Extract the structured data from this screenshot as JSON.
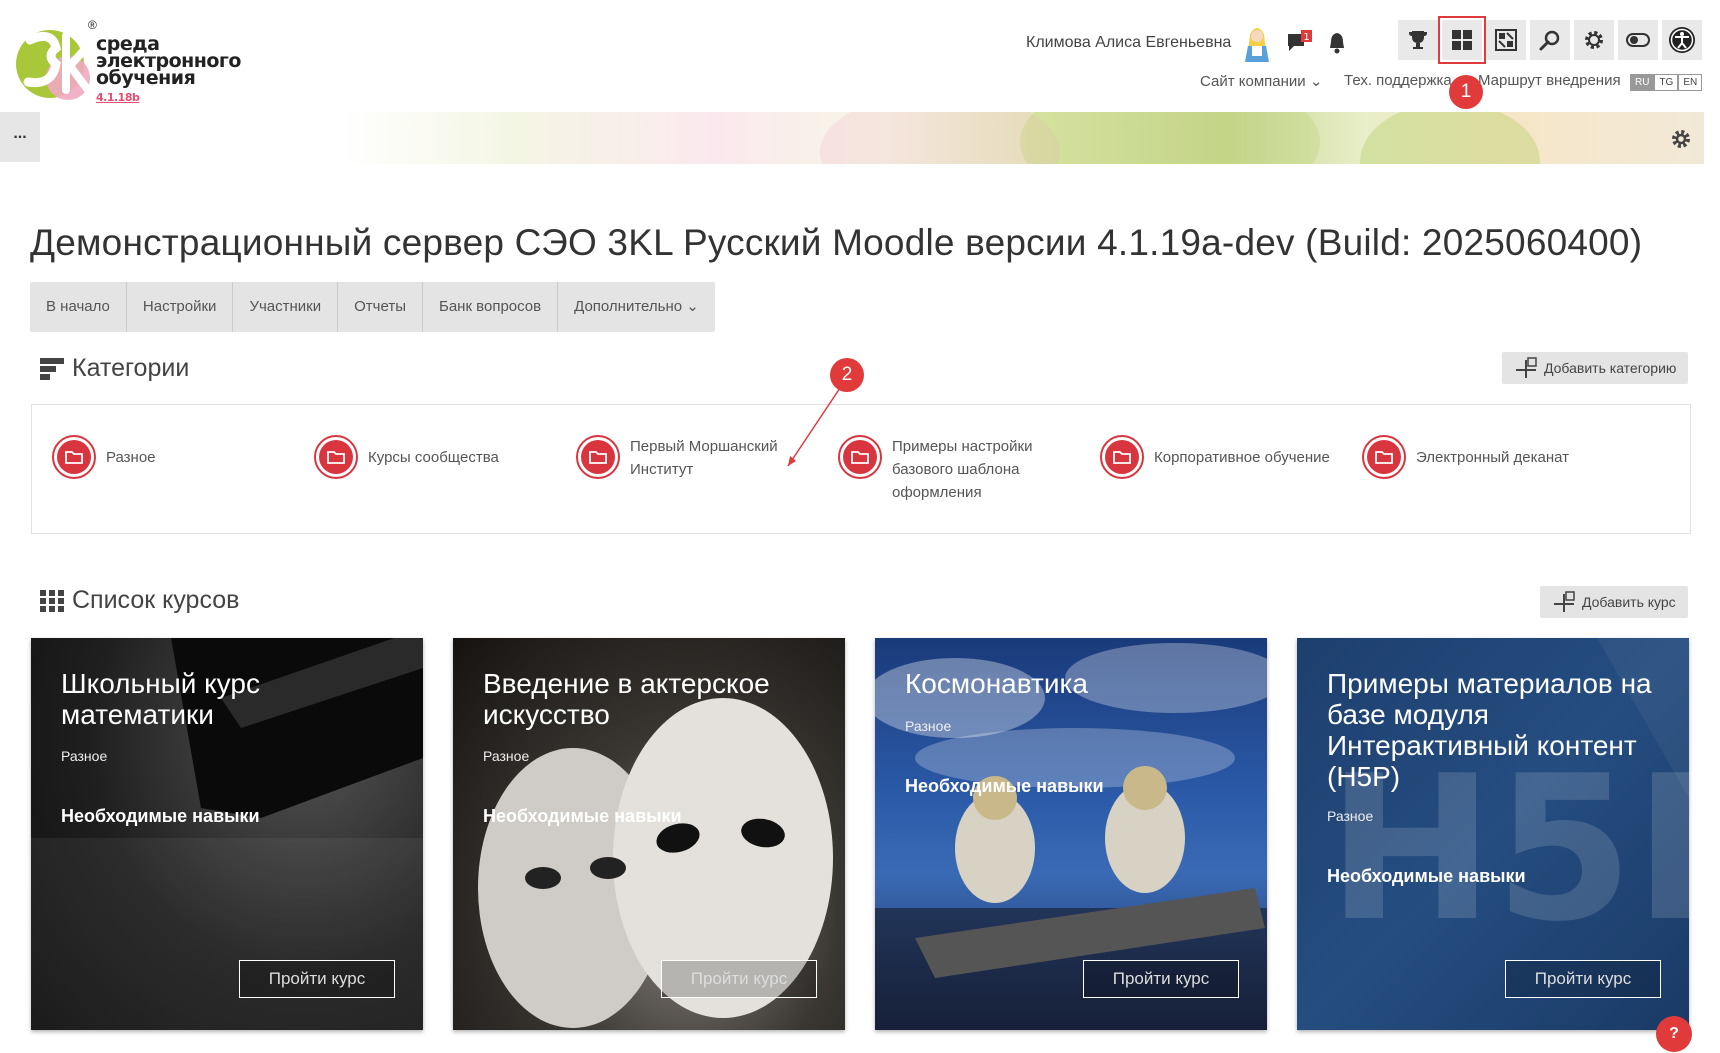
{
  "header": {
    "logo_text_line1": "среда",
    "logo_text_line2": "электронного",
    "logo_text_line3": "обучения",
    "logo_version": "4.1.18b",
    "logo_reg": "®",
    "user_name": "Климова Алиса Евгеньевна",
    "msg_badge": "1",
    "nav_site": "Сайт компании ⌄",
    "nav_support": "Тех. поддержка",
    "nav_route": "Маршрут внедрения",
    "lang": [
      "RU",
      "TG",
      "EN"
    ]
  },
  "annotations": {
    "marker1": "1",
    "marker2": "2"
  },
  "banner": {
    "dots": "..."
  },
  "page": {
    "title": "Демонстрационный сервер СЭО 3KL Русский Moodle версии 4.1.19a-dev (Build: 2025060400)",
    "tabs": [
      "В начало",
      "Настройки",
      "Участники",
      "Отчеты",
      "Банк вопросов",
      "Дополнительно ⌄"
    ]
  },
  "categories": {
    "heading": "Категории",
    "add_label": "Добавить категорию",
    "items": [
      "Разное",
      "Курсы сообщества",
      "Первый Моршанский Институт",
      "Примеры настройки базового шаблона оформления",
      "Корпоративное обучение",
      "Электронный деканат"
    ]
  },
  "courses": {
    "heading": "Список курсов",
    "add_label": "Добавить курс",
    "cards": [
      {
        "title": "Школьный курс математики",
        "category": "Разное",
        "skills": "Необходимые навыки",
        "button": "Пройти курс"
      },
      {
        "title": "Введение в актерское искусство",
        "category": "Разное",
        "skills": "Необходимые навыки",
        "button": "Пройти курс"
      },
      {
        "title": "Космонавтика",
        "category": "Разное",
        "skills": "Необходимые навыки",
        "button": "Пройти курс"
      },
      {
        "title": "Примеры материалов на базе модуля Интерактивный контент (H5P)",
        "category": "Разное",
        "skills": "Необходимые навыки",
        "button": "Пройти курс"
      }
    ]
  },
  "help": "?",
  "colors": {
    "accent": "#e03a3a",
    "category_red": "#d9353f",
    "button_gray": "#e4e4e4"
  },
  "icons": [
    "trophy-icon",
    "dashboard-icon",
    "layout-icon",
    "search-icon",
    "gear-icon",
    "toggle-icon",
    "accessibility-icon",
    "chat-icon",
    "bell-icon",
    "folder-icon"
  ]
}
